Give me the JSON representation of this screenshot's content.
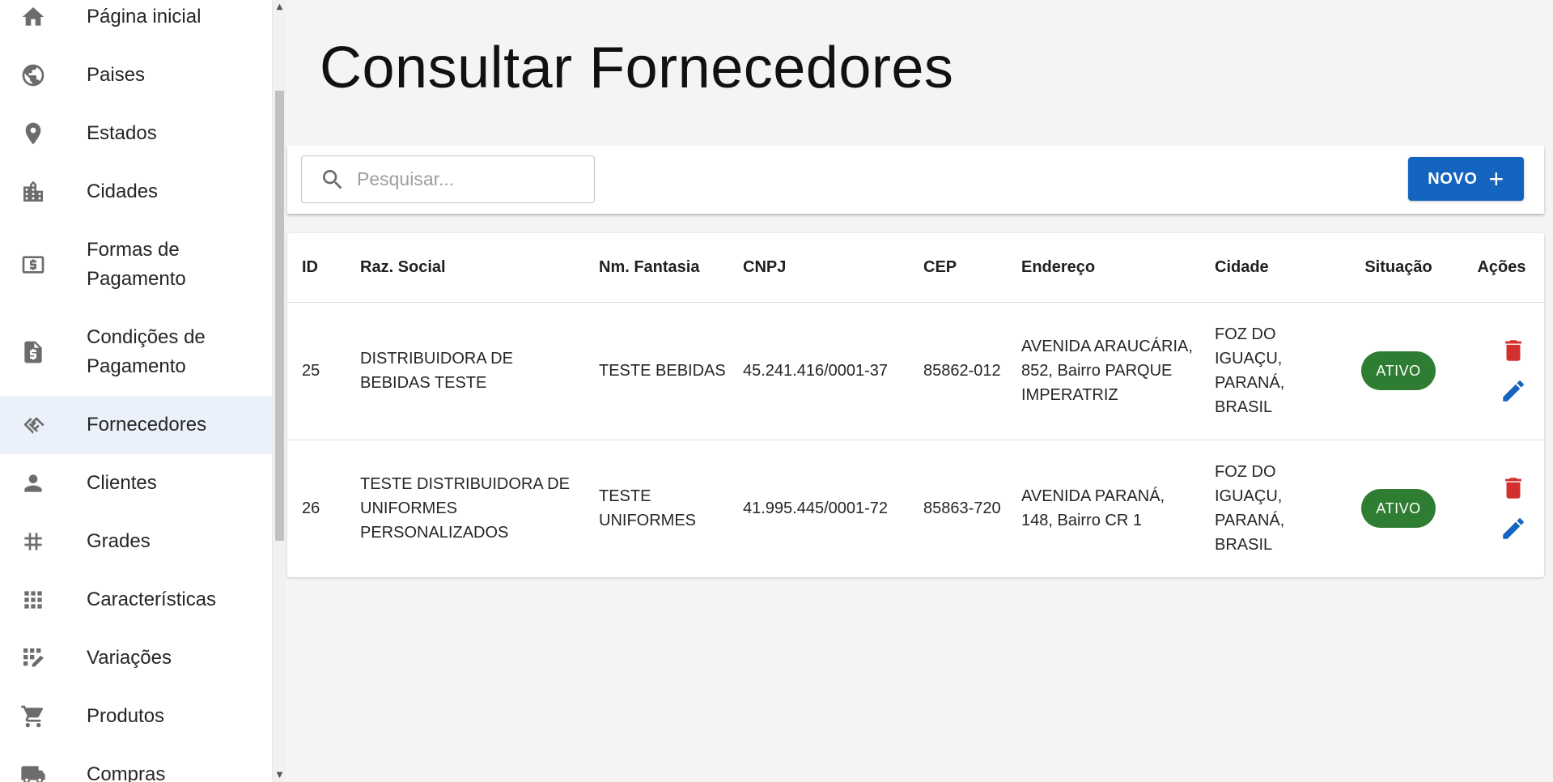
{
  "sidebar": {
    "items": [
      {
        "label": "Página inicial",
        "icon": "home-icon"
      },
      {
        "label": "Paises",
        "icon": "globe-icon"
      },
      {
        "label": "Estados",
        "icon": "location-pin-icon"
      },
      {
        "label": "Cidades",
        "icon": "city-icon"
      },
      {
        "label": "Formas de Pagamento",
        "icon": "payment-card-icon"
      },
      {
        "label": "Condições de Pagamento",
        "icon": "invoice-dollar-icon"
      },
      {
        "label": "Fornecedores",
        "icon": "handshake-icon",
        "active": true
      },
      {
        "label": "Clientes",
        "icon": "person-icon"
      },
      {
        "label": "Grades",
        "icon": "hash-icon"
      },
      {
        "label": "Características",
        "icon": "grid-apps-icon"
      },
      {
        "label": "Variações",
        "icon": "grid-edit-icon"
      },
      {
        "label": "Produtos",
        "icon": "shopping-cart-icon"
      },
      {
        "label": "Compras",
        "icon": "truck-dollar-icon"
      }
    ]
  },
  "page": {
    "title": "Consultar Fornecedores"
  },
  "toolbar": {
    "search_placeholder": "Pesquisar...",
    "search_value": "",
    "new_button_label": "NOVO",
    "new_button_icon": "plus-icon"
  },
  "table": {
    "headers": {
      "id": "ID",
      "razao_social": "Raz. Social",
      "nome_fantasia": "Nm. Fantasia",
      "cnpj": "CNPJ",
      "cep": "CEP",
      "endereco": "Endereço",
      "cidade": "Cidade",
      "situacao": "Situação",
      "acoes": "Ações"
    },
    "rows": [
      {
        "id": "25",
        "razao_social": "DISTRIBUIDORA DE BEBIDAS TESTE",
        "nome_fantasia": "TESTE BEBIDAS",
        "cnpj": "45.241.416/0001-37",
        "cep": "85862-012",
        "endereco": "AVENIDA ARAUCÁRIA, 852, Bairro PARQUE IMPERATRIZ",
        "cidade": "FOZ DO IGUAÇU, PARANÁ, BRASIL",
        "situacao": "ATIVO"
      },
      {
        "id": "26",
        "razao_social": "TESTE DISTRIBUIDORA DE UNIFORMES PERSONALIZADOS",
        "nome_fantasia": "TESTE UNIFORMES",
        "cnpj": "41.995.445/0001-72",
        "cep": "85863-720",
        "endereco": "AVENIDA PARANÁ, 148, Bairro CR 1",
        "cidade": "FOZ DO IGUAÇU, PARANÁ, BRASIL",
        "situacao": "ATIVO"
      }
    ],
    "delete_icon": "trash-icon",
    "edit_icon": "pencil-icon"
  },
  "colors": {
    "primary": "#1565c0",
    "status_active": "#2e7d32",
    "delete": "#d32f2f",
    "edit": "#1565c0",
    "sidebar_active": "#ebf1fa",
    "background": "#f5f4f2"
  }
}
